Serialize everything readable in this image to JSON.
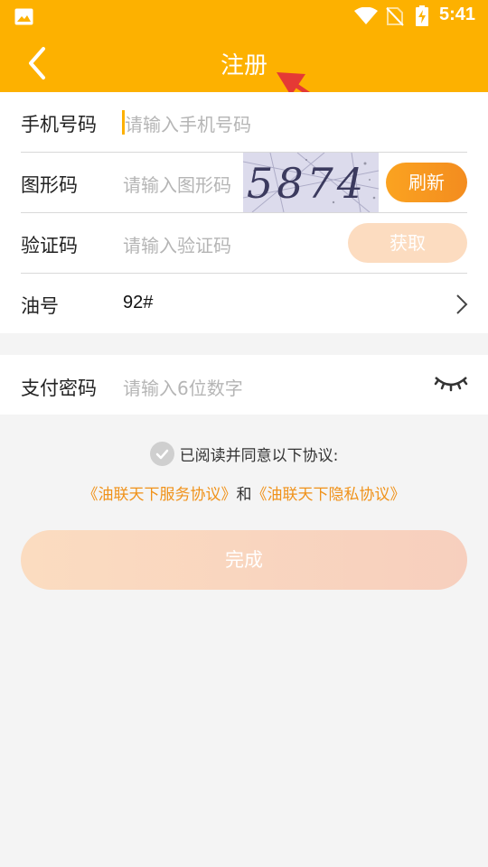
{
  "status_bar": {
    "time": "5:41"
  },
  "app_bar": {
    "title": "注册"
  },
  "form": {
    "phone": {
      "label": "手机号码",
      "placeholder": "请输入手机号码"
    },
    "captcha": {
      "label": "图形码",
      "placeholder": "请输入图形码",
      "image_text": "5874",
      "refresh_label": "刷新"
    },
    "sms_code": {
      "label": "验证码",
      "placeholder": "请输入验证码",
      "get_label": "获取"
    },
    "oil": {
      "label": "油号",
      "value": "92#"
    },
    "pay_password": {
      "label": "支付密码",
      "placeholder": "请输入6位数字"
    }
  },
  "agreement": {
    "text": "已阅读并同意以下协议:",
    "service_link": "《油联天下服务协议》",
    "and": "和",
    "privacy_link": "《油联天下隐私协议》"
  },
  "submit_label": "完成",
  "colors": {
    "brand": "#FDB100",
    "accent": "#F38C1F",
    "link": "#F0921A",
    "disabled_button": "#FCDCC0"
  },
  "icons": [
    "image-icon",
    "wifi-icon",
    "no-sim-icon",
    "battery-icon",
    "back-arrow-icon",
    "chevron-right-icon",
    "eye-closed-icon",
    "check-icon"
  ]
}
